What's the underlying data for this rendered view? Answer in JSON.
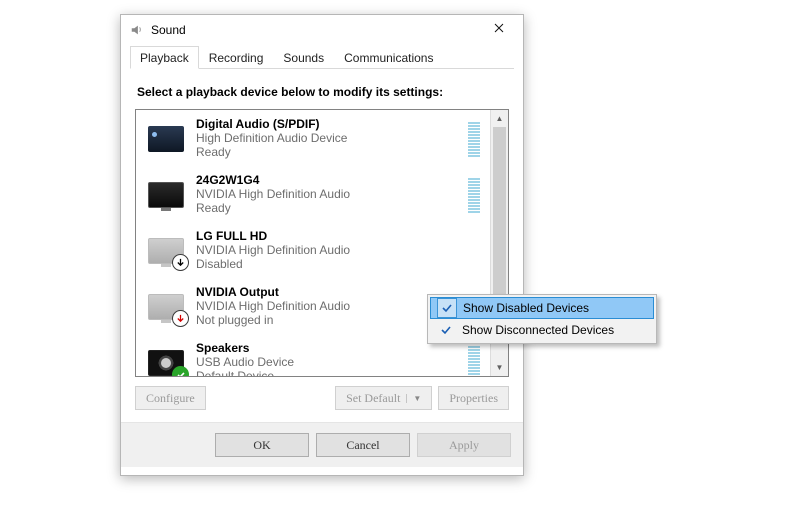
{
  "window": {
    "title": "Sound"
  },
  "tabs": [
    "Playback",
    "Recording",
    "Sounds",
    "Communications"
  ],
  "activeTab": 0,
  "instruction": "Select a playback device below to modify its settings:",
  "devices": [
    {
      "name": "Digital Audio (S/PDIF)",
      "desc": "High Definition Audio Device",
      "status": "Ready",
      "icon": "spdif",
      "meter": true,
      "badge": null
    },
    {
      "name": "24G2W1G4",
      "desc": "NVIDIA High Definition Audio",
      "status": "Ready",
      "icon": "mon",
      "meter": true,
      "badge": null
    },
    {
      "name": "LG FULL HD",
      "desc": "NVIDIA High Definition Audio",
      "status": "Disabled",
      "icon": "mon-dim",
      "meter": false,
      "badge": "down-black"
    },
    {
      "name": "NVIDIA Output",
      "desc": "NVIDIA High Definition Audio",
      "status": "Not plugged in",
      "icon": "mon-dim",
      "meter": false,
      "badge": "down-red"
    },
    {
      "name": "Speakers",
      "desc": "USB Audio Device",
      "status": "Default Device",
      "icon": "spk",
      "meter": true,
      "badge": "check-green"
    }
  ],
  "buttons": {
    "configure": "Configure",
    "setDefault": "Set Default",
    "properties": "Properties",
    "ok": "OK",
    "cancel": "Cancel",
    "apply": "Apply"
  },
  "contextMenu": {
    "items": [
      {
        "label": "Show Disabled Devices",
        "checked": true,
        "highlight": true
      },
      {
        "label": "Show Disconnected Devices",
        "checked": true,
        "highlight": false
      }
    ]
  }
}
